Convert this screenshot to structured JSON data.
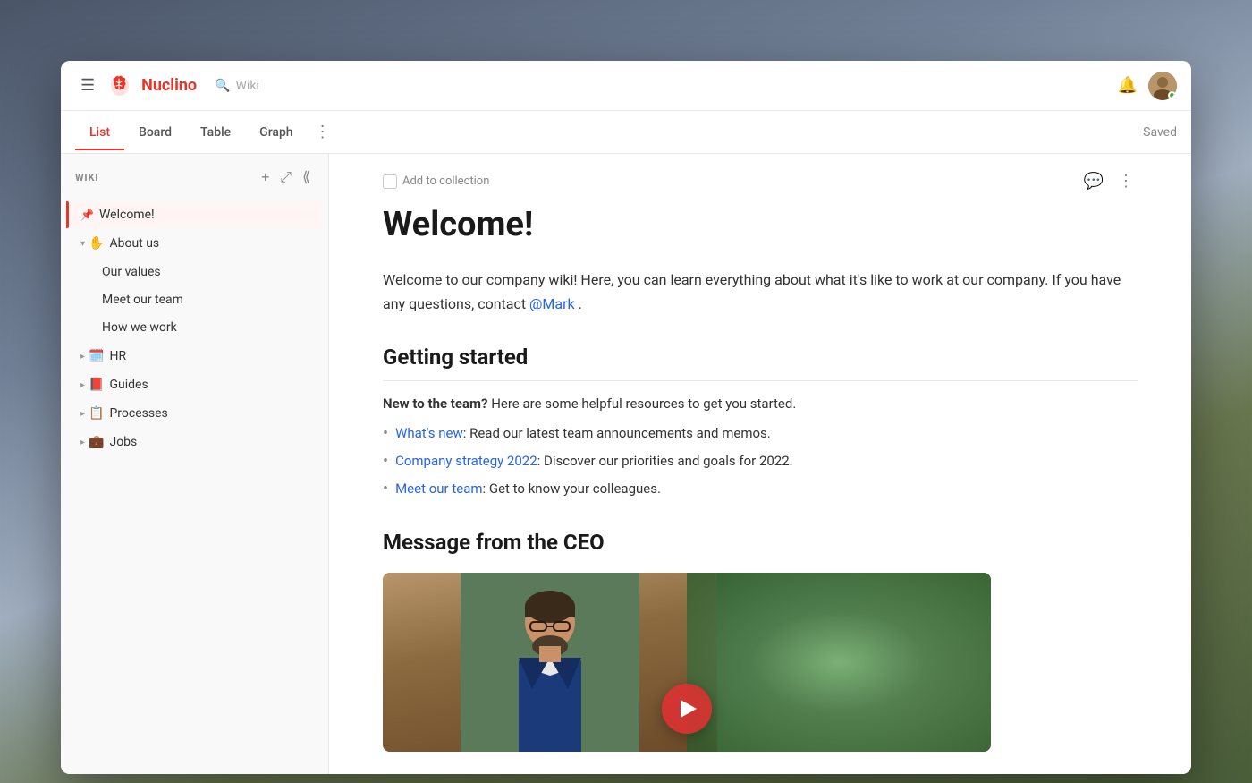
{
  "background": {
    "gradient": "mountain scene"
  },
  "topbar": {
    "logo_text": "Nuclino",
    "search_placeholder": "Wiki",
    "saved_label": "Saved"
  },
  "tabs": {
    "items": [
      {
        "id": "list",
        "label": "List",
        "active": true
      },
      {
        "id": "board",
        "label": "Board",
        "active": false
      },
      {
        "id": "table",
        "label": "Table",
        "active": false
      },
      {
        "id": "graph",
        "label": "Graph",
        "active": false
      }
    ],
    "more_icon": "⋮",
    "status": "Saved"
  },
  "sidebar": {
    "wiki_label": "WIKI",
    "items": [
      {
        "id": "welcome",
        "label": "Welcome!",
        "emoji": "📌",
        "pinned": true,
        "active": true,
        "indent": 0
      },
      {
        "id": "about-us",
        "label": "About us",
        "emoji": "✋",
        "expanded": true,
        "indent": 0,
        "children": [
          {
            "id": "our-values",
            "label": "Our values",
            "indent": 1
          },
          {
            "id": "meet-our-team",
            "label": "Meet our team",
            "indent": 1
          },
          {
            "id": "how-we-work",
            "label": "How we work",
            "indent": 1
          }
        ]
      },
      {
        "id": "hr",
        "label": "HR",
        "emoji": "🗓️",
        "expanded": false,
        "indent": 0
      },
      {
        "id": "guides",
        "label": "Guides",
        "emoji": "📕",
        "expanded": false,
        "indent": 0
      },
      {
        "id": "processes",
        "label": "Processes",
        "emoji": "📋",
        "expanded": false,
        "indent": 0
      },
      {
        "id": "jobs",
        "label": "Jobs",
        "emoji": "💼",
        "expanded": false,
        "indent": 0
      }
    ]
  },
  "content": {
    "add_to_collection": "Add to collection",
    "page_title": "Welcome!",
    "intro_text": "Welcome to our company wiki! Here, you can learn everything about what it's like to work at our company. If you have any questions, contact",
    "mention": "@Mark",
    "intro_end": ".",
    "getting_started_title": "Getting started",
    "new_to_team_label": "New to the team?",
    "new_to_team_text": "Here are some helpful resources to get you started.",
    "bullets": [
      {
        "link_text": "What's new",
        "text": ": Read our latest team announcements and memos."
      },
      {
        "link_text": "Company strategy 2022",
        "text": ": Discover our priorities and goals for 2022."
      },
      {
        "link_text": "Meet our team",
        "text": ": Get to know your colleagues."
      }
    ],
    "ceo_section_title": "Message from the CEO"
  }
}
